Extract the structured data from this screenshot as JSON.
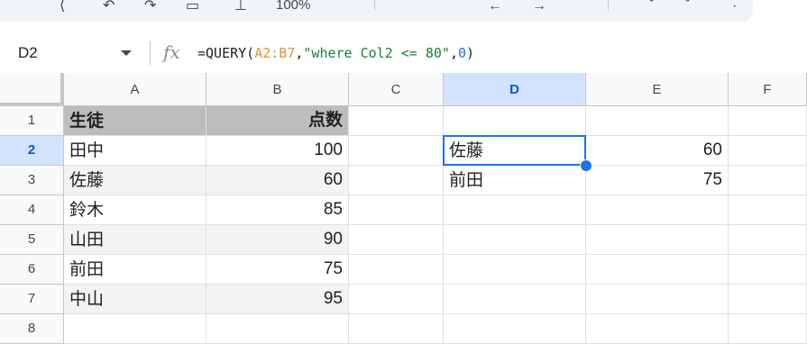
{
  "toolbar": {
    "zoom": "100%"
  },
  "formula_bar": {
    "cell_ref": "D2",
    "fx_label": "fx",
    "formula_prefix": "=QUERY(",
    "formula_range": "A2:B7",
    "formula_comma1": ",",
    "formula_string": "\"where Col2 <= 80\"",
    "formula_comma2": ",",
    "formula_number": "0",
    "formula_suffix": ")"
  },
  "grid": {
    "columns": [
      "A",
      "B",
      "C",
      "D",
      "E",
      "F"
    ],
    "active_column": "D",
    "rows": [
      "1",
      "2",
      "3",
      "4",
      "5",
      "6",
      "7",
      "8"
    ],
    "active_row": "2",
    "cells": {
      "A1": "生徒",
      "B1": "点数",
      "A2": "田中",
      "B2": "100",
      "A3": "佐藤",
      "B3": "60",
      "A4": "鈴木",
      "B4": "85",
      "A5": "山田",
      "B5": "90",
      "A6": "前田",
      "B6": "75",
      "A7": "中山",
      "B7": "95",
      "D2": "佐藤",
      "E2": "60",
      "D3": "前田",
      "E3": "75"
    }
  },
  "colors": {
    "accent": "#1a73e8",
    "header_fill": "#bdbdbd",
    "band_fill": "#f3f3f3",
    "active_header": "#d3e3fd",
    "formula_range": "#e69138",
    "formula_string": "#188038",
    "formula_number": "#1a73e8"
  }
}
